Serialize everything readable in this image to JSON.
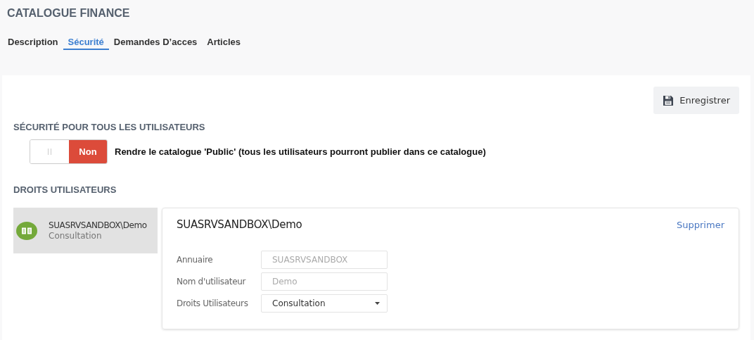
{
  "title": "CATALOGUE FINANCE",
  "tabs": [
    {
      "label": "Description",
      "selected": false
    },
    {
      "label": "Sécurité",
      "selected": true
    },
    {
      "label": "Demandes D’acces",
      "selected": false
    },
    {
      "label": "Articles",
      "selected": false
    }
  ],
  "save_button": "Enregistrer",
  "security_heading": "SÉCURITÉ POUR TOUS LES UTILISATEURS",
  "public_toggle": {
    "on": false,
    "state_label": "Non",
    "description": "Rendre le catalogue 'Public' (tous les utilisateurs pourront publier dans ce catalogue)"
  },
  "rights_heading": "DROITS UTILISATEURS",
  "users": [
    {
      "name": "SUASRVSANDBOX\\Demo",
      "role": "Consultation",
      "selected": true
    }
  ],
  "detail": {
    "title": "SUASRVSANDBOX\\Demo",
    "delete_link": "Supprimer",
    "fields": [
      {
        "label": "Annuaire",
        "value": "SUASRVSANDBOX",
        "kind": "text",
        "disabled": true
      },
      {
        "label": "Nom d'utilisateur",
        "value": "Demo",
        "kind": "text",
        "disabled": true
      },
      {
        "label": "Droits Utilisateurs",
        "value": "Consultation",
        "kind": "select",
        "disabled": false
      }
    ]
  }
}
